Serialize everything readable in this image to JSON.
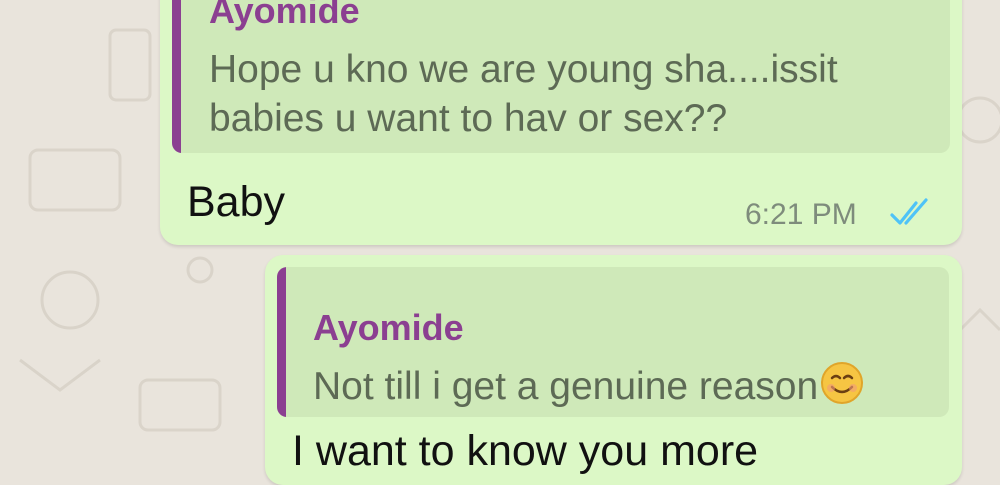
{
  "messages": [
    {
      "quote": {
        "author": "Ayomide",
        "text_lines": [
          "Hope u kno we are young sha....issit",
          "babies u want to hav or sex??"
        ]
      },
      "text": "Baby",
      "time": "6:21 PM",
      "status_icon": "double-check-read-icon"
    },
    {
      "quote": {
        "author": "Ayomide",
        "text": "Not till i get a genuine reason",
        "emoji": "smiling-face-emoji"
      },
      "text": "I want to know you more"
    }
  ],
  "colors": {
    "outgoing_bubble": "#dcf8c6",
    "quote_background": "#cfe9b9",
    "quote_accent": "#8b3f91",
    "read_ticks": "#4fc3f7",
    "wallpaper": "#e9e4dc"
  }
}
